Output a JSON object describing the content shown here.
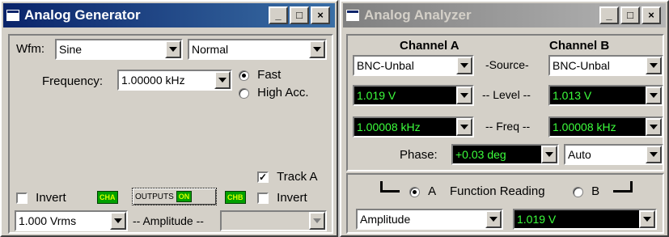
{
  "generator": {
    "title": "Analog Generator",
    "wfm_label": "Wfm:",
    "waveform": "Sine",
    "mode": "Normal",
    "frequency_label": "Frequency:",
    "frequency": "1.00000 kHz",
    "fast_label": "Fast",
    "high_acc_label": "High Acc.",
    "fast_selected": true,
    "track_label": "Track A",
    "track_checked": true,
    "invert_a_label": "Invert",
    "invert_b_label": "Invert",
    "cha_badge": "CHA",
    "chb_badge": "CHB",
    "outputs_label": "OUTPUTS",
    "outputs_state": "ON",
    "amplitude_value": "1.000  Vrms",
    "amplitude_label": "-- Amplitude --",
    "amplitude_b_value": ""
  },
  "analyzer": {
    "title": "Analog Analyzer",
    "channel_a": "Channel A",
    "channel_b": "Channel B",
    "source_label": "-Source-",
    "source_a": "BNC-Unbal",
    "source_b": "BNC-Unbal",
    "level_label": "-- Level --",
    "level_a": "1.019  V",
    "level_b": "1.013  V",
    "freq_label": "-- Freq --",
    "freq_a": "1.00008 kHz",
    "freq_b": "1.00008 kHz",
    "phase_label": "Phase:",
    "phase_value": "+0.03   deg",
    "phase_mode": "Auto",
    "radio_a_label": "A",
    "function_label": "Function Reading",
    "radio_b_label": "B",
    "function": "Amplitude",
    "function_value": "1.019  V"
  },
  "window_buttons": {
    "minimize": "_",
    "maximize": "□",
    "close": "×"
  },
  "colors": {
    "active_title": "#0a246a",
    "inactive_title": "#808080",
    "reading_text": "#3cff3c",
    "reading_bg": "#000000"
  }
}
